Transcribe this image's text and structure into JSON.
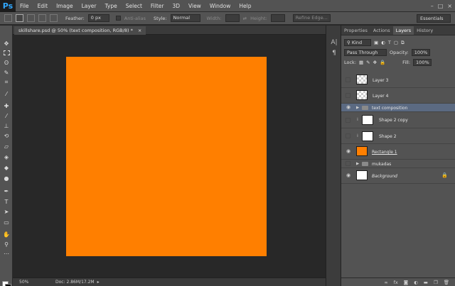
{
  "app": {
    "logo": "Ps"
  },
  "menu": [
    "File",
    "Edit",
    "Image",
    "Layer",
    "Type",
    "Select",
    "Filter",
    "3D",
    "View",
    "Window",
    "Help"
  ],
  "window_controls": [
    "–",
    "□",
    "×"
  ],
  "options": {
    "feather_label": "Feather:",
    "feather_value": "0 px",
    "antialias_label": "Anti-alias",
    "style_label": "Style:",
    "style_value": "Normal",
    "width_label": "Width:",
    "height_label": "Height:",
    "refine_label": "Refine Edge...",
    "workspace": "Essentials"
  },
  "document": {
    "tab_label": "skillshare.psd @ 50% (text composition, RGB/8) *",
    "tab_close": "×",
    "zoom": "50%",
    "doc_info": "Doc: 2.86M/17.2M",
    "fill_color": "#ff7f00"
  },
  "colors": {
    "foreground": "#ffffff",
    "background": "#000000"
  },
  "panel": {
    "tabs": [
      "Properties",
      "Actions",
      "Layers",
      "History"
    ],
    "active_tab": "Layers",
    "kind_label": "Kind",
    "blend_mode": "Pass Through",
    "opacity_label": "Opacity:",
    "opacity_value": "100%",
    "lock_label": "Lock:",
    "fill_label": "Fill:",
    "fill_value": "100%",
    "layers": [
      {
        "name": "Layer 3",
        "visible": false,
        "type": "pixel"
      },
      {
        "name": "Layer 4",
        "visible": false,
        "type": "pixel"
      },
      {
        "name": "text composition",
        "visible": true,
        "type": "group",
        "selected": true
      },
      {
        "name": "Shape 2 copy",
        "visible": false,
        "type": "shape"
      },
      {
        "name": "Shape 2",
        "visible": false,
        "type": "shape"
      },
      {
        "name": "Rectangle 1",
        "visible": true,
        "type": "rectangle",
        "color": "#ff7f00"
      },
      {
        "name": "mukadas",
        "visible": false,
        "type": "group"
      },
      {
        "name": "Background",
        "visible": true,
        "type": "background",
        "locked": true
      }
    ]
  }
}
